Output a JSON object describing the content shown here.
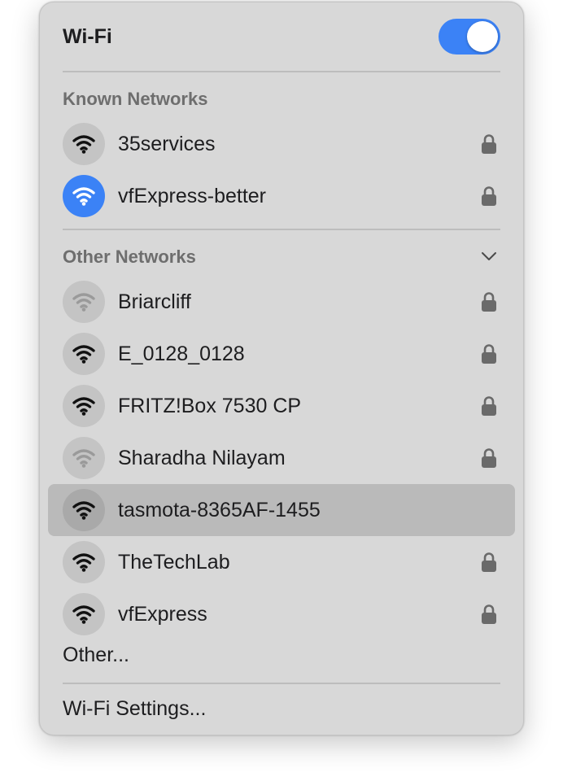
{
  "header": {
    "title": "Wi-Fi",
    "wifi_enabled": true
  },
  "colors": {
    "accent": "#3b82f6",
    "menu_bg": "#d8d8d8",
    "highlight": "#bababa"
  },
  "known_networks": {
    "label": "Known Networks",
    "items": [
      {
        "name": "35services",
        "locked": true,
        "connected": false,
        "signal": "strong"
      },
      {
        "name": "vfExpress-better",
        "locked": true,
        "connected": true,
        "signal": "strong"
      }
    ]
  },
  "other_networks": {
    "label": "Other Networks",
    "expand_icon": "chevron-down-icon",
    "items": [
      {
        "name": "Briarcliff",
        "locked": true,
        "signal": "weak"
      },
      {
        "name": "E_0128_0128",
        "locked": true,
        "signal": "strong"
      },
      {
        "name": "FRITZ!Box 7530 CP",
        "locked": true,
        "signal": "strong"
      },
      {
        "name": "Sharadha Nilayam",
        "locked": true,
        "signal": "weak"
      },
      {
        "name": "tasmota-8365AF-1455",
        "locked": false,
        "signal": "strong",
        "highlighted": true
      },
      {
        "name": "TheTechLab",
        "locked": true,
        "signal": "strong"
      },
      {
        "name": "vfExpress",
        "locked": true,
        "signal": "strong"
      }
    ]
  },
  "footer": {
    "other_label": "Other...",
    "settings_label": "Wi-Fi Settings..."
  }
}
